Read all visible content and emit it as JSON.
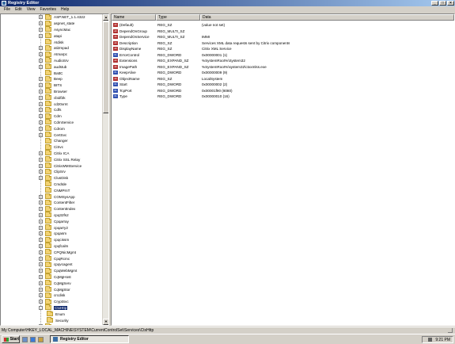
{
  "window": {
    "title": "Registry Editor",
    "icon": "registry-icon"
  },
  "menu": [
    "File",
    "Edit",
    "View",
    "Favorites",
    "Help"
  ],
  "tree": {
    "items": [
      {
        "label": "ASP.NET_1.1.4322",
        "expander": "+"
      },
      {
        "label": "aspnet_state",
        "expander": "+"
      },
      {
        "label": "AsyncMac",
        "expander": "+"
      },
      {
        "label": "atapi",
        "expander": "+"
      },
      {
        "label": "Atdisk",
        "expander": ""
      },
      {
        "label": "ati2mpad",
        "expander": "+"
      },
      {
        "label": "Atmarpc",
        "expander": "+"
      },
      {
        "label": "AudioSrv",
        "expander": "+"
      },
      {
        "label": "audstub",
        "expander": "+"
      },
      {
        "label": "BattC",
        "expander": ""
      },
      {
        "label": "Beep",
        "expander": "+"
      },
      {
        "label": "BITS",
        "expander": "+"
      },
      {
        "label": "Browser",
        "expander": "+"
      },
      {
        "label": "cbidf2k",
        "expander": "+"
      },
      {
        "label": "cd20xrnt",
        "expander": "+"
      },
      {
        "label": "Cdfs",
        "expander": "+"
      },
      {
        "label": "Cdm",
        "expander": "+"
      },
      {
        "label": "CdmService",
        "expander": "+"
      },
      {
        "label": "Cdrom",
        "expander": "+"
      },
      {
        "label": "CertSvc",
        "expander": "+"
      },
      {
        "label": "Changer",
        "expander": ""
      },
      {
        "label": "CiSvc",
        "expander": ""
      },
      {
        "label": "Citrix ICA",
        "expander": "+"
      },
      {
        "label": "Citrix SSL Relay",
        "expander": "+"
      },
      {
        "label": "CitrixWMIService",
        "expander": "+"
      },
      {
        "label": "ClipSrv",
        "expander": "+"
      },
      {
        "label": "ClusDisk",
        "expander": "+"
      },
      {
        "label": "CmdIde",
        "expander": ""
      },
      {
        "label": "CNMPrnT",
        "expander": ""
      },
      {
        "label": "COMSysApp",
        "expander": "+"
      },
      {
        "label": "ContentFilter",
        "expander": "+"
      },
      {
        "label": "ContentIndex",
        "expander": "+"
      },
      {
        "label": "cpq32fs2",
        "expander": "+"
      },
      {
        "label": "Cpqarray",
        "expander": "+"
      },
      {
        "label": "cpqarry2",
        "expander": "+"
      },
      {
        "label": "cpqasm",
        "expander": "+"
      },
      {
        "label": "cpqcissm",
        "expander": "+"
      },
      {
        "label": "cpqfcalm",
        "expander": "+"
      },
      {
        "label": "CPQNicMgmt",
        "expander": "+"
      },
      {
        "label": "CpqRcmc",
        "expander": "+"
      },
      {
        "label": "cpqvcagent",
        "expander": "+"
      },
      {
        "label": "CpqWebMgmt",
        "expander": "+"
      },
      {
        "label": "CqMgHost",
        "expander": "+"
      },
      {
        "label": "CqMgServ",
        "expander": "+"
      },
      {
        "label": "CqMgStor",
        "expander": "+"
      },
      {
        "label": "crcdisk",
        "expander": "+"
      },
      {
        "label": "CryptSvc",
        "expander": "+"
      },
      {
        "label": "CtxHttp",
        "expander": "-",
        "selected": true
      },
      {
        "label": "Enum",
        "expander": "",
        "indent": 1
      },
      {
        "label": "Security",
        "expander": "",
        "indent": 1
      },
      {
        "label": "CtxSecGwy",
        "expander": "+"
      }
    ]
  },
  "columns": [
    "Name",
    "Type",
    "Data"
  ],
  "values": [
    {
      "name": "(Default)",
      "type": "REG_SZ",
      "data": "(value not set)",
      "kind": "sz"
    },
    {
      "name": "DependOnGroup",
      "type": "REG_MULTI_SZ",
      "data": "",
      "kind": "sz"
    },
    {
      "name": "DependOnService",
      "type": "REG_MULTI_SZ",
      "data": "IMMI",
      "kind": "sz"
    },
    {
      "name": "Description",
      "type": "REG_SZ",
      "data": "Services XML data requests sent by Citrix components",
      "kind": "sz"
    },
    {
      "name": "DisplayName",
      "type": "REG_SZ",
      "data": "Citrix XML Service",
      "kind": "sz"
    },
    {
      "name": "ErrorControl",
      "type": "REG_DWORD",
      "data": "0x00000001 (1)",
      "kind": "bin"
    },
    {
      "name": "Extensions",
      "type": "REG_EXPAND_SZ",
      "data": "%SystemRoot%\\System32",
      "kind": "sz"
    },
    {
      "name": "ImagePath",
      "type": "REG_EXPAND_SZ",
      "data": "%SystemRoot%\\system32\\ctxxmlss.exe",
      "kind": "sz"
    },
    {
      "name": "KeepAlive",
      "type": "REG_DWORD",
      "data": "0x00000009 (9)",
      "kind": "bin"
    },
    {
      "name": "ObjectName",
      "type": "REG_SZ",
      "data": "LocalSystem",
      "kind": "sz"
    },
    {
      "name": "Start",
      "type": "REG_DWORD",
      "data": "0x00000002 (2)",
      "kind": "bin"
    },
    {
      "name": "TcpPort",
      "type": "REG_DWORD",
      "data": "0x00001f90 (8080)",
      "kind": "bin"
    },
    {
      "name": "Type",
      "type": "REG_DWORD",
      "data": "0x00000010 (16)",
      "kind": "bin"
    }
  ],
  "status": {
    "path": "My Computer\\HKEY_LOCAL_MACHINE\\SYSTEM\\CurrentControlSet\\Services\\CtxHttp"
  },
  "taskbar": {
    "start_label": "Start",
    "task_label": "Registry Editor",
    "clock": "9:21 PM"
  }
}
